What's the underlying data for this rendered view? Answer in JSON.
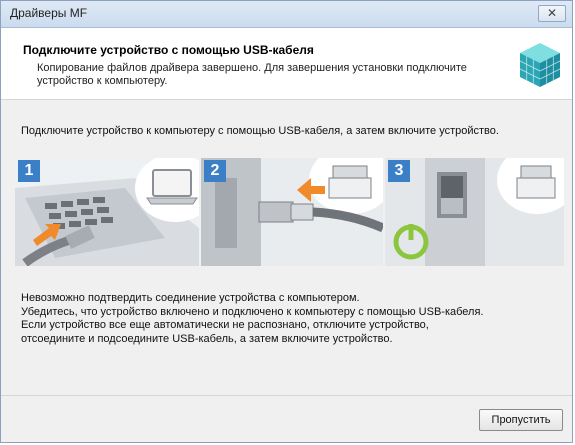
{
  "window": {
    "title": "Драйверы MF",
    "close_label": "✕"
  },
  "header": {
    "title": "Подключите устройство с помощью USB-кабеля",
    "subtitle": "Копирование файлов драйвера завершено. Для завершения установки подключите устройство к компьютеру."
  },
  "instruction": "Подключите устройство к компьютеру с помощью USB-кабеля, а затем включите устройство.",
  "steps": [
    {
      "number": "1",
      "icon": "usb-plug-laptop"
    },
    {
      "number": "2",
      "icon": "usb-plug-printer"
    },
    {
      "number": "3",
      "icon": "power-switch-on"
    }
  ],
  "status_lines": [
    "Невозможно подтвердить соединение устройства с компьютером.",
    "Убедитесь, что устройство включено и подключено к компьютеру с помощью USB-кабеля.",
    "Если устройство все еще автоматически не распознано, отключите устройство,",
    "отсоедините и подсоедините USB-кабель, а затем включите устройство."
  ],
  "buttons": {
    "skip": "Пропустить"
  },
  "colors": {
    "step_badge": "#3b7fc7",
    "arrow": "#f08a2a",
    "power_ring": "#8cc63f"
  }
}
